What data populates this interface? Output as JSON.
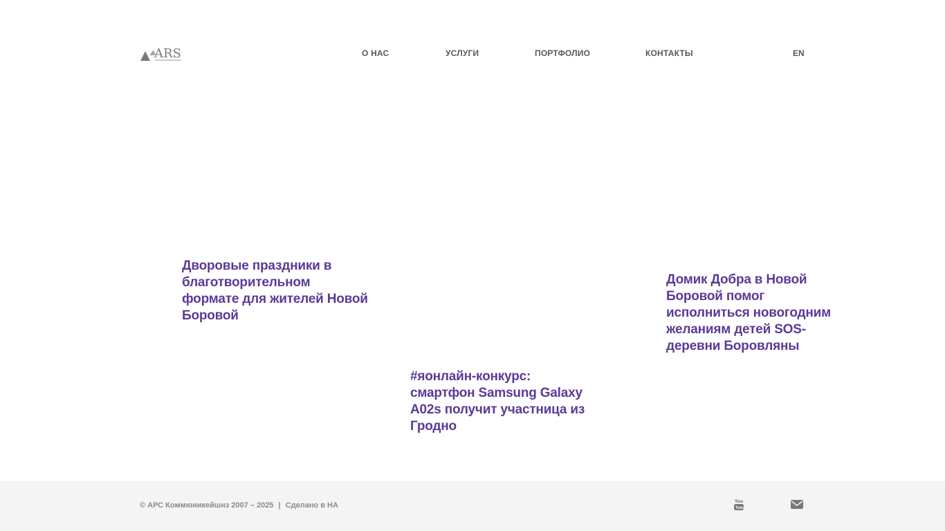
{
  "header": {
    "logo_text": "ARS",
    "nav": {
      "about": "О НАС",
      "services": "УСЛУГИ",
      "portfolio": "ПОРТФОЛИО",
      "contacts": "КОНТАКТЫ"
    },
    "lang": "EN"
  },
  "posts": [
    {
      "title": "Дворовые праздники в благотворительном формате для жителей Новой Боровой"
    },
    {
      "title": "#яонлайн-конкурс: смартфон Samsung Galaxy A02s получит участница из Гродно"
    },
    {
      "title": "Домик Добра в Новой Боровой помог исполниться новогодним желаниям детей SOS-деревни Боровляны"
    }
  ],
  "footer": {
    "copyright": "© АРС Коммюникейшнз 2007 – 2025",
    "separator": "|",
    "made_by": "Сделано в НА",
    "social": [
      {
        "icon": "youtube-icon"
      },
      {
        "icon": "mail-icon"
      }
    ]
  },
  "colors": {
    "accent": "#5b3a96",
    "nav_text": "#595959",
    "footer_bg": "#f4f4f4",
    "footer_text": "#8a8a8a",
    "icon": "#777777"
  }
}
